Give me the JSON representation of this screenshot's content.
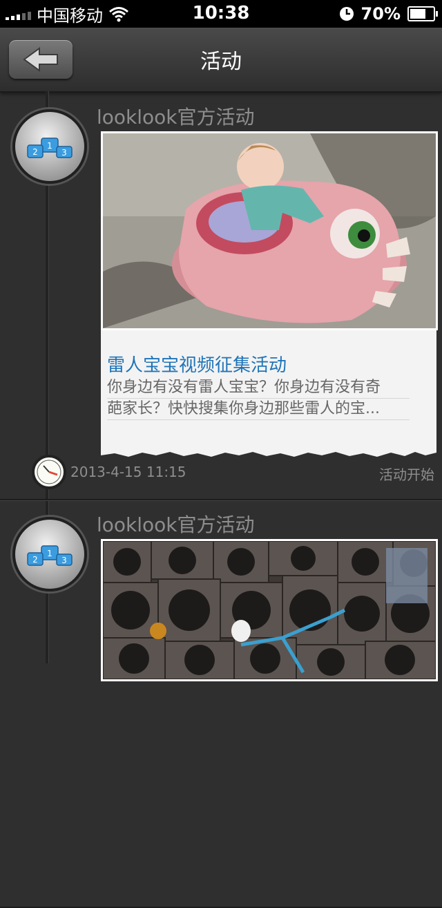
{
  "status_bar": {
    "carrier": "中国移动",
    "time": "10:38",
    "battery": "70%",
    "battery_level": 0.7
  },
  "nav": {
    "title": "活动",
    "back_icon": "back-arrow-icon"
  },
  "posts": [
    {
      "author": "looklook官方活动",
      "badge_icon": "podium-icon",
      "image_alt": "baby riding a pink monster-head cart",
      "title": "雷人宝宝视频征集活动",
      "desc_line1": "你身边有没有雷人宝宝？你身边有没有奇",
      "desc_line2": "葩家长？快快搜集你身边那些雷人的宝...",
      "date": "2013-4-15  11:15",
      "status": "活动开始"
    },
    {
      "author": "looklook官方活动",
      "badge_icon": "podium-icon",
      "image_alt": "wall of speakers with a bicycle"
    }
  ]
}
